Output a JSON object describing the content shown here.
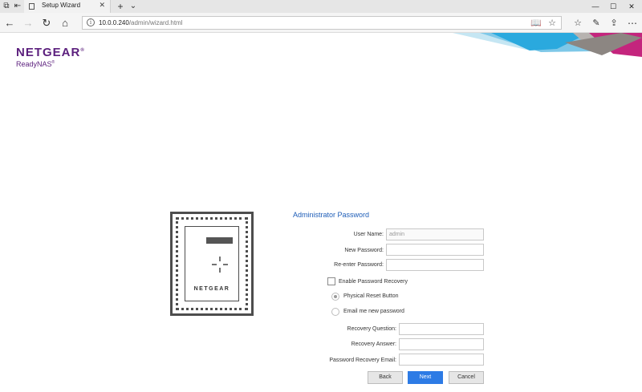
{
  "browser": {
    "tab_title": "Setup Wizard",
    "url_host": "10.0.0.240",
    "url_path": "/admin/wizard.html"
  },
  "logo": {
    "brand": "NETGEAR",
    "registered": "®",
    "product": "ReadyNAS",
    "product_mark": "®"
  },
  "device": {
    "brand": "NETGEAR"
  },
  "form": {
    "title": "Administrator Password",
    "user_name_label": "User Name:",
    "user_name_value": "admin",
    "new_password_label": "New Password:",
    "reenter_password_label": "Re-enter Password:",
    "enable_recovery_label": "Enable Password Recovery",
    "physical_reset_label": "Physical Reset Button",
    "email_new_password_label": "Email me new password",
    "recovery_question_label": "Recovery Question:",
    "recovery_answer_label": "Recovery Answer:",
    "recovery_email_label": "Password Recovery Email:",
    "enable_recovery_checked": false,
    "selected_recovery_option": "physical-reset"
  },
  "buttons": {
    "back": "Back",
    "next": "Next",
    "cancel": "Cancel"
  },
  "colors": {
    "brand_purple": "#5b1f7d",
    "title_blue": "#1f5eb8",
    "primary_button": "#2d7be5"
  },
  "icons": [
    "tab-list-icon",
    "tab-aside-icon",
    "page-icon",
    "close-icon",
    "new-tab-icon",
    "chevron-down-icon",
    "minimize-icon",
    "maximize-icon",
    "window-close-icon",
    "back-arrow-icon",
    "forward-arrow-icon",
    "refresh-icon",
    "home-icon",
    "info-icon",
    "reading-view-icon",
    "favorite-star-icon",
    "favorites-hub-icon",
    "pen-icon",
    "share-icon",
    "more-icon"
  ]
}
